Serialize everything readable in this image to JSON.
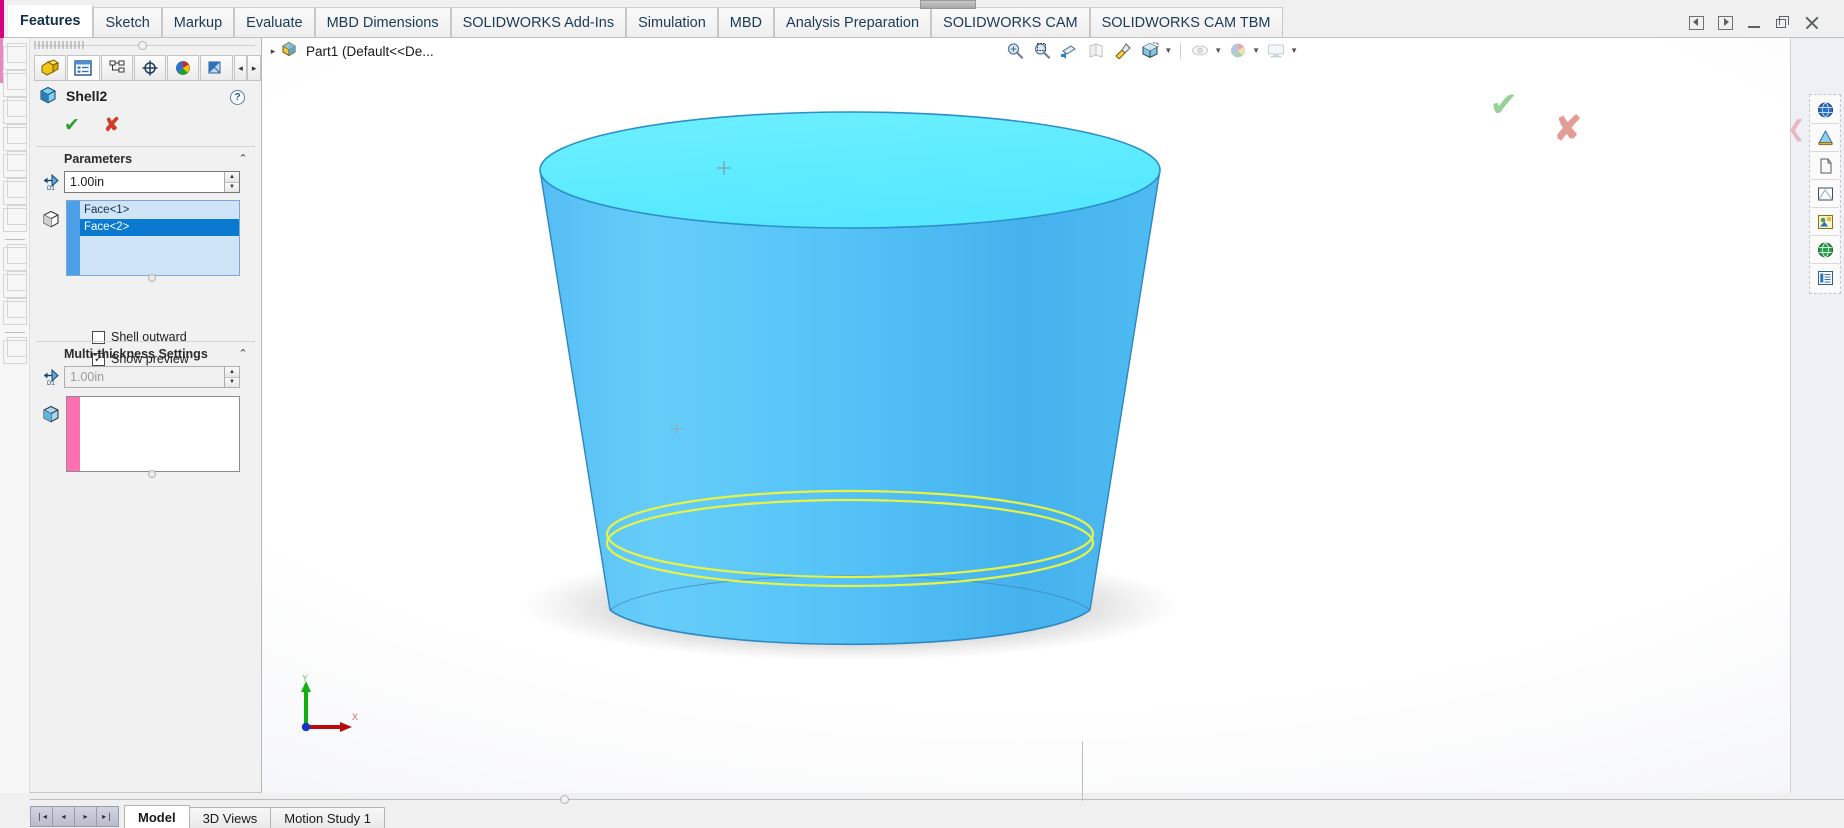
{
  "window": {
    "controls": [
      "prev-pane",
      "next-pane",
      "minimize",
      "restore",
      "close"
    ]
  },
  "ribbon": {
    "tabs": [
      {
        "label": "Features",
        "active": true
      },
      {
        "label": "Sketch",
        "active": false
      },
      {
        "label": "Markup",
        "active": false
      },
      {
        "label": "Evaluate",
        "active": false
      },
      {
        "label": "MBD Dimensions",
        "active": false
      },
      {
        "label": "SOLIDWORKS Add-Ins",
        "active": false
      },
      {
        "label": "Simulation",
        "active": false
      },
      {
        "label": "MBD",
        "active": false
      },
      {
        "label": "Analysis Preparation",
        "active": false
      },
      {
        "label": "SOLIDWORKS CAM",
        "active": false
      },
      {
        "label": "SOLIDWORKS CAM TBM",
        "active": false
      }
    ]
  },
  "property_manager": {
    "tabs": [
      {
        "name": "feature-manager-tree-tab",
        "selected": false
      },
      {
        "name": "property-manager-tab",
        "selected": true
      },
      {
        "name": "configuration-manager-tab",
        "selected": false
      },
      {
        "name": "dimxpert-manager-tab",
        "selected": false
      },
      {
        "name": "display-manager-tab",
        "selected": false
      },
      {
        "name": "cam-feature-tree-tab",
        "selected": false
      }
    ],
    "tabs_more_label": "▸",
    "tabs_less_label": "◂",
    "feature_title": "Shell2",
    "accept_label": "✔",
    "cancel_label": "✘",
    "help_label": "?",
    "parameters": {
      "heading": "Parameters",
      "collapse_label": "⌃",
      "thickness_value": "1.00in",
      "thickness_icon_label": "D1",
      "faces": [
        {
          "label": "Face<1>",
          "selected": false
        },
        {
          "label": "Face<2>",
          "selected": true
        }
      ],
      "shell_outward": {
        "label": "Shell outward",
        "checked": false,
        "mark": ""
      },
      "show_preview": {
        "label": "Show preview",
        "checked": true,
        "mark": "✓"
      }
    },
    "multi_thickness": {
      "heading": "Multi-thickness Settings",
      "collapse_label": "⌃",
      "thickness_value": "1.00in",
      "thickness_icon_label": "D1",
      "faces": []
    }
  },
  "graphics": {
    "tree_expand_label": "▸",
    "document_label": "Part1  (Default<<De...",
    "view_toolbar": [
      {
        "name": "zoom-to-fit-icon"
      },
      {
        "name": "zoom-to-area-icon"
      },
      {
        "name": "previous-view-icon"
      },
      {
        "name": "section-view-icon"
      },
      {
        "name": "view-orientation-icon"
      },
      {
        "name": "display-style-icon"
      },
      {
        "name": "hide-show-items-icon"
      },
      {
        "name": "edit-appearance-icon"
      },
      {
        "name": "apply-scene-icon"
      },
      {
        "name": "view-settings-icon"
      }
    ],
    "confirm_check_label": "✔",
    "confirm_cancel_label": "✘",
    "triad": {
      "y_label": "Y",
      "x_label": "X",
      "y_color": "#00a000",
      "x_color": "#c00000",
      "origin_color": "#0033cc"
    },
    "model": {
      "name": "tapered-cup-shell-preview",
      "top_face_color": "#5eeaff",
      "side_color_light": "#5ec8f7",
      "side_color_dark": "#3fb2ef",
      "edge_color": "#2a7fb8",
      "preview_highlight_color": "#e8f54a"
    }
  },
  "task_pane": {
    "collapse_label": "❮",
    "items": [
      {
        "name": "solidworks-resources-icon"
      },
      {
        "name": "design-library-icon"
      },
      {
        "name": "file-explorer-icon"
      },
      {
        "name": "view-palette-icon"
      },
      {
        "name": "appearances-scenes-decals-icon"
      },
      {
        "name": "custom-properties-icon"
      },
      {
        "name": "solidworks-forum-icon"
      }
    ]
  },
  "bottom": {
    "nav_buttons": [
      "❘◂",
      "◂",
      "▸",
      "▸❘"
    ],
    "tabs": [
      {
        "label": "Model",
        "active": true
      },
      {
        "label": "3D Views",
        "active": false
      },
      {
        "label": "Motion Study 1",
        "active": false
      }
    ]
  }
}
